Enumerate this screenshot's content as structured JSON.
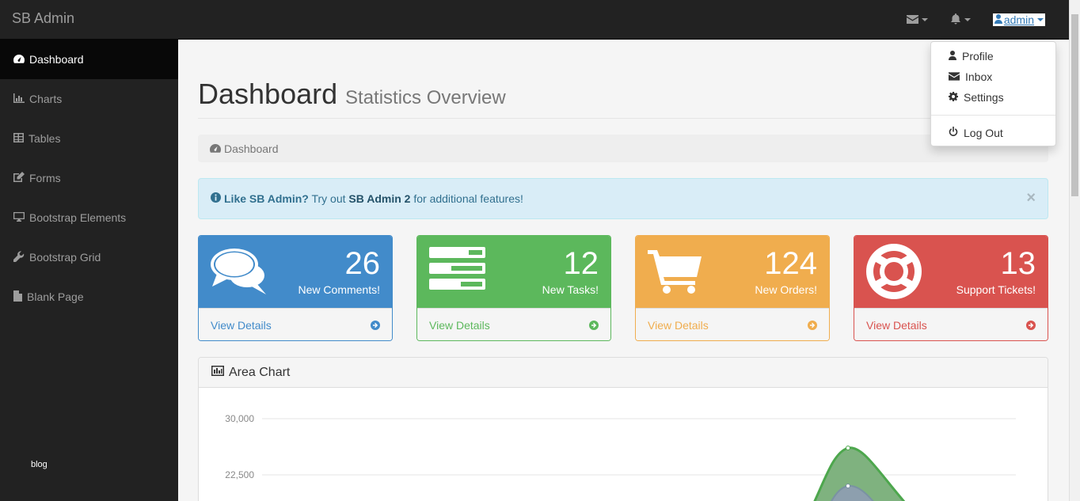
{
  "navbar": {
    "brand": "SB Admin",
    "messages_icon": "envelope-icon",
    "alerts_icon": "bell-icon",
    "user_label": "admin"
  },
  "user_menu": {
    "items": [
      {
        "label": "Profile",
        "icon": "user-icon"
      },
      {
        "label": "Inbox",
        "icon": "envelope-icon"
      },
      {
        "label": "Settings",
        "icon": "gear-icon"
      },
      {
        "label": "Log Out",
        "icon": "power-icon"
      }
    ]
  },
  "sidebar": {
    "items": [
      {
        "label": "Dashboard",
        "icon": "dashboard-icon",
        "active": true
      },
      {
        "label": "Charts",
        "icon": "bar-chart-icon"
      },
      {
        "label": "Tables",
        "icon": "table-icon"
      },
      {
        "label": "Forms",
        "icon": "edit-icon"
      },
      {
        "label": "Bootstrap Elements",
        "icon": "desktop-icon"
      },
      {
        "label": "Bootstrap Grid",
        "icon": "wrench-icon"
      },
      {
        "label": "Blank Page",
        "icon": "file-icon"
      }
    ],
    "footer": "blog"
  },
  "header": {
    "title": "Dashboard",
    "subtitle": "Statistics Overview"
  },
  "breadcrumb": {
    "label": "Dashboard"
  },
  "alert": {
    "lead": "Like SB Admin?",
    "text_1": " Try out ",
    "link": "SB Admin 2",
    "text_2": " for additional features!",
    "close": "×"
  },
  "panels": [
    {
      "value": "26",
      "label": "New Comments!",
      "link": "View Details",
      "color": "#428bca",
      "icon": "comments-icon"
    },
    {
      "value": "12",
      "label": "New Tasks!",
      "link": "View Details",
      "color": "#5cb85c",
      "icon": "tasks-icon"
    },
    {
      "value": "124",
      "label": "New Orders!",
      "link": "View Details",
      "color": "#f0ad4e",
      "icon": "shopping-cart-icon"
    },
    {
      "value": "13",
      "label": "Support Tickets!",
      "link": "View Details",
      "color": "#d9534f",
      "icon": "life-ring-icon"
    }
  ],
  "area_chart": {
    "title": "Area Chart",
    "icon": "bar-chart-icon"
  },
  "chart_data": {
    "type": "area",
    "title": "Area Chart",
    "ytick_labels": [
      "30,000",
      "22,500"
    ],
    "series_colors": [
      "#4da74d",
      "#7a92a3"
    ],
    "grid": true
  }
}
